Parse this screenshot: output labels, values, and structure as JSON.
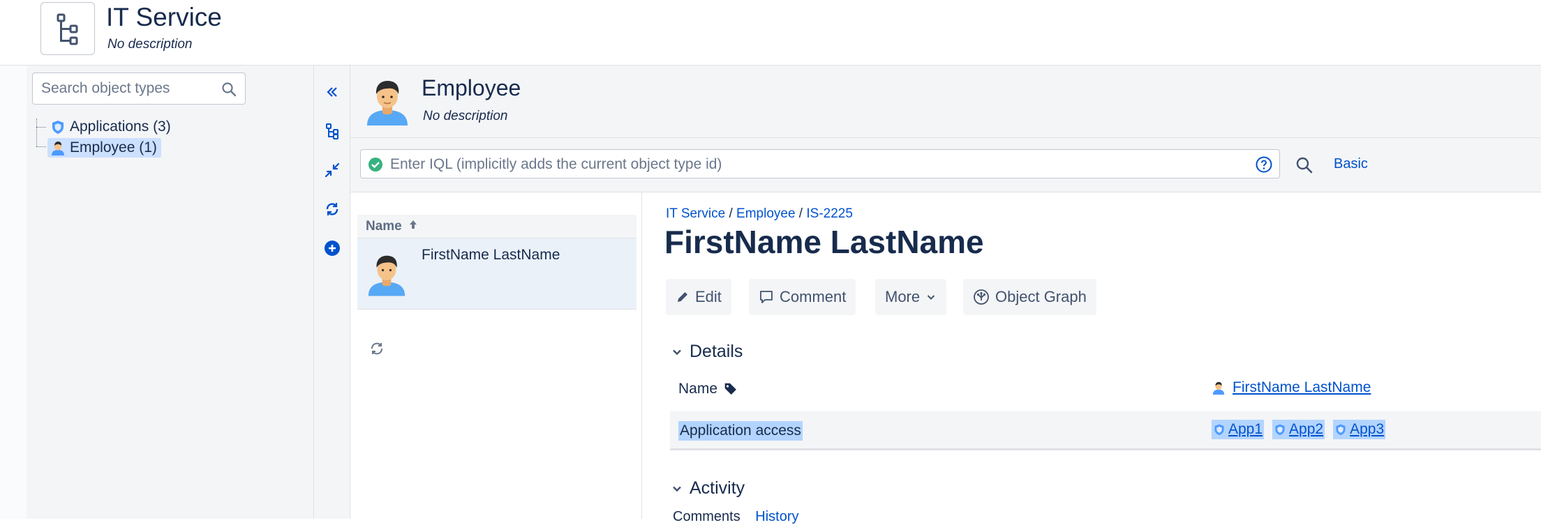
{
  "schema": {
    "title": "IT Service",
    "description": "No description"
  },
  "tree": {
    "search_placeholder": "Search object types",
    "items": [
      {
        "label": "Applications (3)",
        "icon": "app-shield-icon"
      },
      {
        "label": "Employee (1)",
        "icon": "person-icon",
        "selected": true
      }
    ]
  },
  "toolbar": {
    "buttons": [
      "collapse-panel-icon",
      "object-type-tree-icon",
      "minimize-icon",
      "refresh-icon",
      "add-icon"
    ]
  },
  "object_type": {
    "title": "Employee",
    "description": "No description"
  },
  "iql": {
    "placeholder": "Enter IQL (implicitly adds the current object type id)",
    "mode_link": "Basic"
  },
  "list": {
    "column_header": "Name",
    "rows": [
      {
        "name": "FirstName LastName"
      }
    ]
  },
  "detail": {
    "breadcrumb": [
      "IT Service",
      "Employee",
      "IS-2225"
    ],
    "breadcrumb_sep": " / ",
    "title": "FirstName LastName",
    "actions": {
      "edit": "Edit",
      "comment": "Comment",
      "more": "More",
      "graph": "Object Graph"
    },
    "sections": {
      "details": "Details",
      "activity": "Activity"
    },
    "attributes": [
      {
        "label": "Name",
        "value": "FirstName LastName"
      },
      {
        "label": "Application access",
        "values": [
          "App1",
          "App2",
          "App3"
        ]
      }
    ],
    "activity_sub": [
      "Comments",
      "History"
    ]
  },
  "colors": {
    "link": "#0052cc",
    "highlight": "#b3d4ff",
    "selected": "#cce0ff",
    "panel": "#f4f5f7",
    "text": "#172b4d"
  }
}
